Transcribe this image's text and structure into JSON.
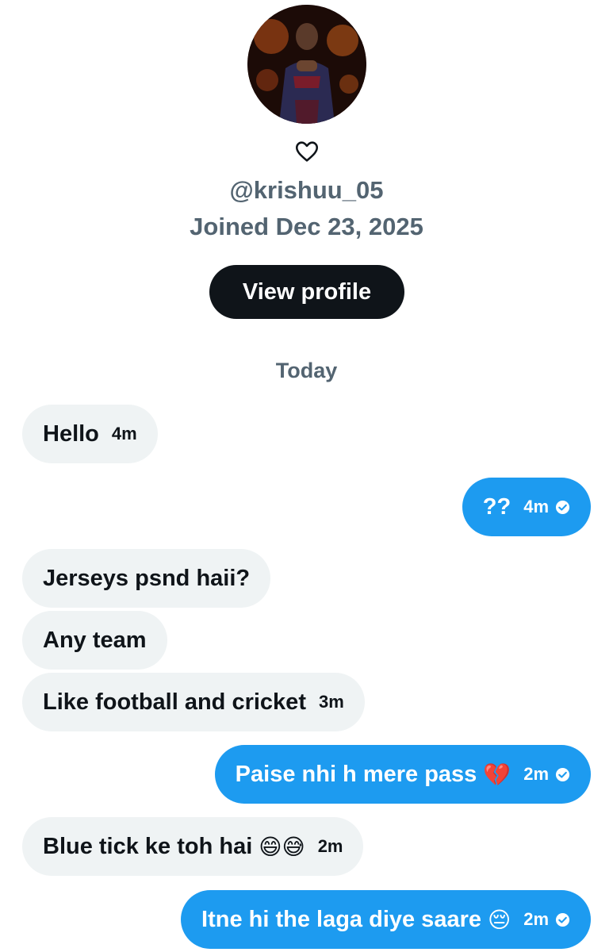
{
  "profile": {
    "handle": "@krishuu_05",
    "joined": "Joined Dec 23, 2025",
    "heart_icon": "outline-heart-icon",
    "view_profile_label": "View profile"
  },
  "day_separator": "Today",
  "colors": {
    "outgoing_bubble": "#1d9bf0",
    "incoming_bubble": "#eff3f4",
    "muted_text": "#536471",
    "button_dark": "#0f1419"
  },
  "messages": [
    {
      "direction": "in",
      "text": "Hello",
      "time": "4m"
    },
    {
      "direction": "out",
      "text": "??",
      "time": "4m",
      "status_icon": "read-check-icon"
    },
    {
      "direction": "in",
      "text": "Jerseys psnd haii?"
    },
    {
      "direction": "in",
      "text": "Any team"
    },
    {
      "direction": "in",
      "text": "Like football and cricket",
      "time": "3m"
    },
    {
      "direction": "out",
      "text": "Paise nhi h mere pass",
      "emoji": "💔",
      "time": "2m",
      "status_icon": "read-check-icon"
    },
    {
      "direction": "in",
      "text": "Blue tick ke toh hai",
      "emoji": "😄😅",
      "time": "2m"
    },
    {
      "direction": "out",
      "text": "Itne hi the laga diye saare",
      "emoji": "😔",
      "time": "2m",
      "status_icon": "read-check-icon"
    }
  ]
}
